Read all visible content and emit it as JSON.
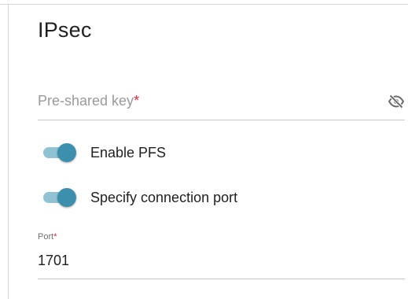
{
  "section": {
    "title": "IPsec"
  },
  "psk_field": {
    "placeholder": "Pre-shared key",
    "required_mark": "*",
    "visibility_icon": "eye-slash-icon"
  },
  "toggles": {
    "pfs": {
      "label": "Enable PFS",
      "on": true
    },
    "port": {
      "label": "Specify connection port",
      "on": true
    }
  },
  "port_field": {
    "label": "Port",
    "required_mark": "*",
    "value": "1701"
  },
  "colors": {
    "accent": "#3c8fad",
    "track": "#90c2d3",
    "required": "#e0283a"
  }
}
